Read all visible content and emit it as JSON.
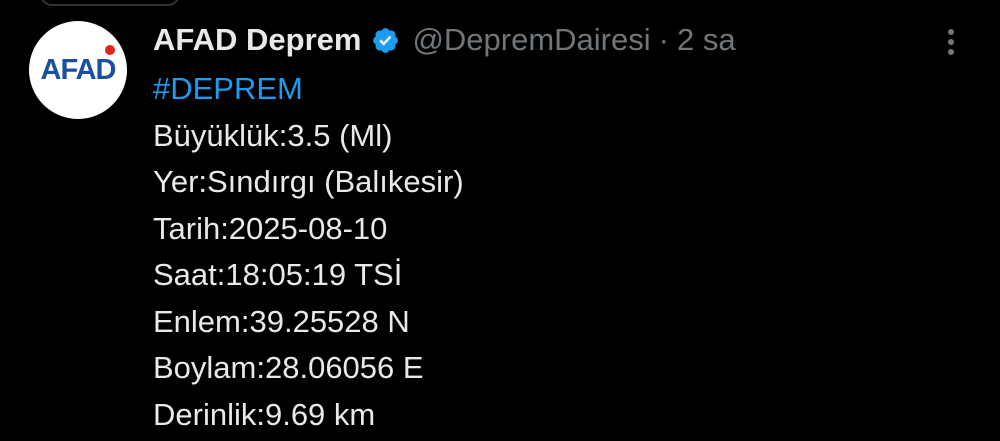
{
  "tweet": {
    "author": {
      "name": "AFAD Deprem",
      "handle": "@DepremDairesi",
      "avatar_text": "AFAD",
      "verified_icon": "verified-badge-icon"
    },
    "separator": "·",
    "time": "2 sa",
    "more_icon": "more-vertical-icon",
    "hashtag": "#DEPREM",
    "lines": [
      "Büyüklük:3.5 (Ml)",
      "Yer:Sındırgı (Balıkesir)",
      "Tarih:2025-08-10",
      "Saat:18:05:19 TSİ",
      "Enlem:39.25528 N",
      "Boylam:28.06056 E",
      "Derinlik:9.69 km"
    ]
  },
  "colors": {
    "background": "#000000",
    "text": "#e7e9ea",
    "muted": "#71767b",
    "link": "#1d9bf0",
    "verified": "#1d9bf0",
    "avatar_text": "#1b4fa0",
    "avatar_accent": "#e1251b"
  }
}
